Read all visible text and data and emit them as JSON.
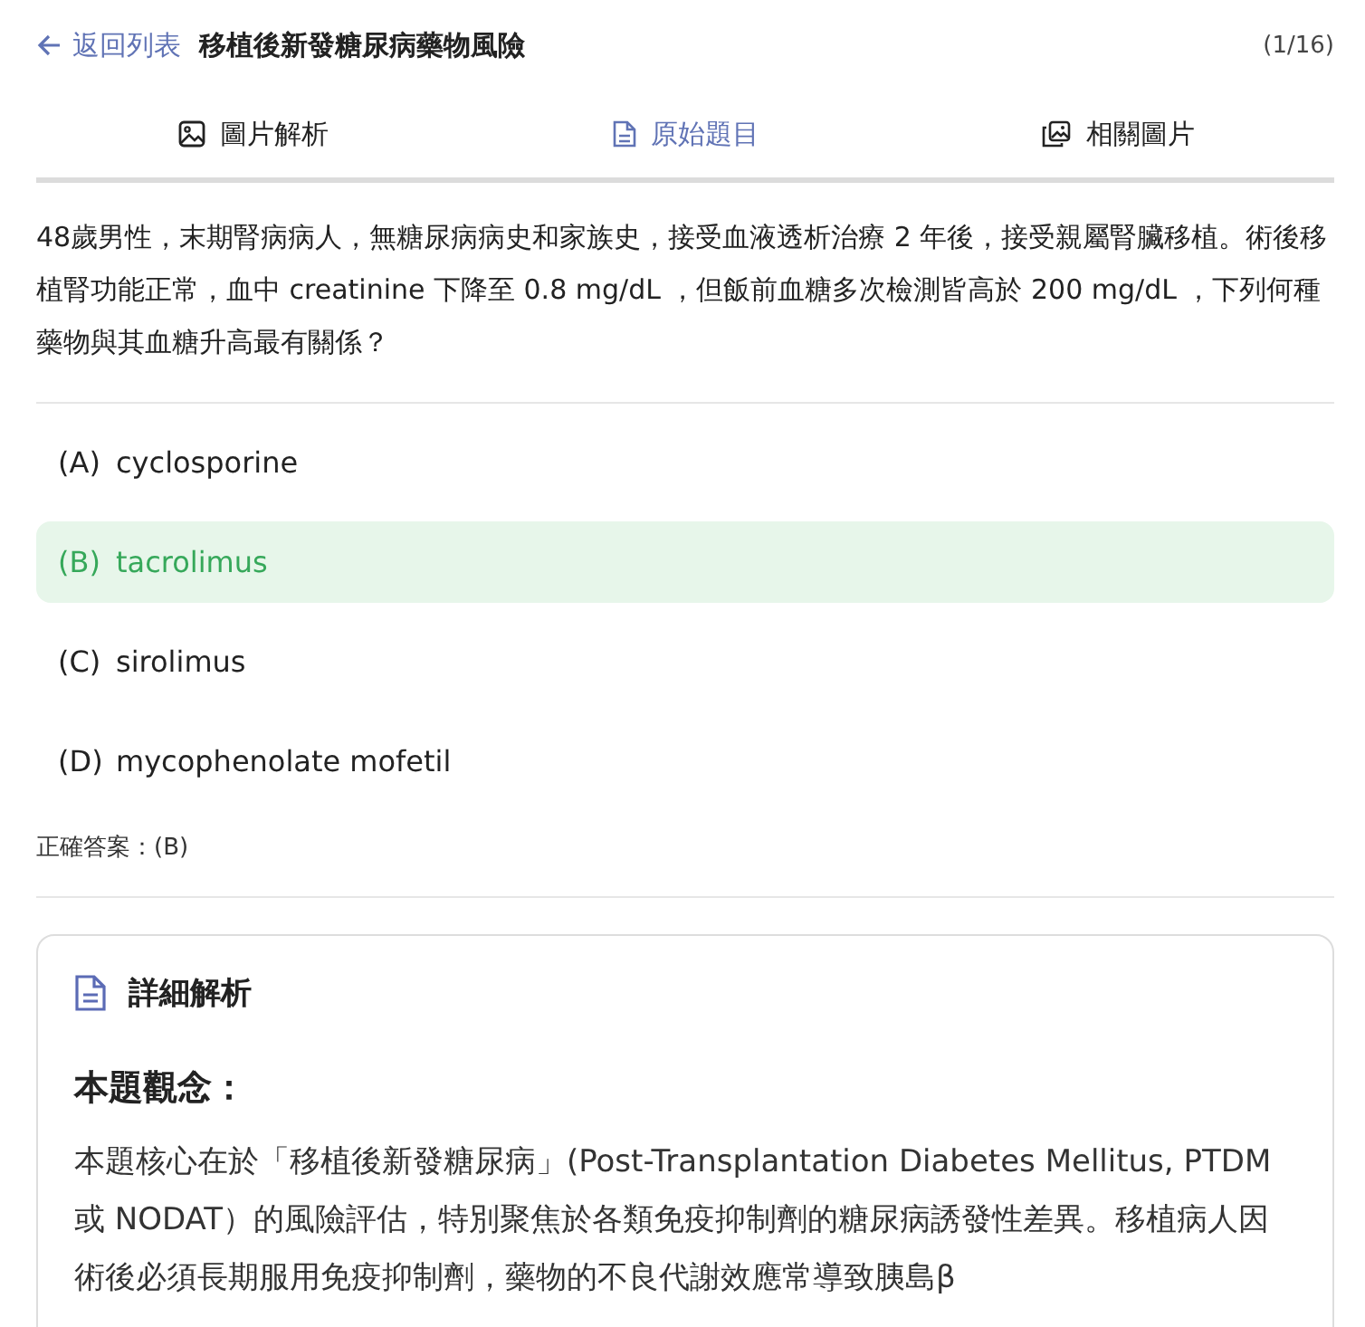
{
  "header": {
    "back_label": "返回列表",
    "title": "移植後新發糖尿病藥物風險",
    "counter": "(1/16)"
  },
  "tabs": [
    {
      "label": "圖片解析",
      "kind": "image",
      "selected": false
    },
    {
      "label": "原始題目",
      "kind": "document",
      "selected": true
    },
    {
      "label": "相關圖片",
      "kind": "images",
      "selected": false
    }
  ],
  "question": "48歲男性，末期腎病病人，無糖尿病病史和家族史，接受血液透析治療 2 年後，接受親屬腎臟移植。術後移植腎功能正常，血中 creatinine 下降至 0.8 mg/dL ，但飯前血糖多次檢測皆高於 200 mg/dL ，下列何種藥物與其血糖升高最有關係？",
  "options": [
    {
      "letter": "(A)",
      "text": "cyclosporine",
      "selected": false
    },
    {
      "letter": "(B)",
      "text": "tacrolimus",
      "selected": true
    },
    {
      "letter": "(C)",
      "text": "sirolimus",
      "selected": false
    },
    {
      "letter": "(D)",
      "text": "mycophenolate mofetil",
      "selected": false
    }
  ],
  "answer": "正確答案：(B)",
  "explanation": {
    "title": "詳細解析",
    "heading": "本題觀念：",
    "paragraph": "本題核心在於「移植後新發糖尿病」(Post-Transplantation Diabetes Mellitus, PTDM 或 NODAT）的風險評估，特別聚焦於各類免疫抑制劑的糖尿病誘發性差異。移植病人因術後必須長期服用免疫抑制劑，藥物的不良代謝效應常導致胰島β"
  }
}
